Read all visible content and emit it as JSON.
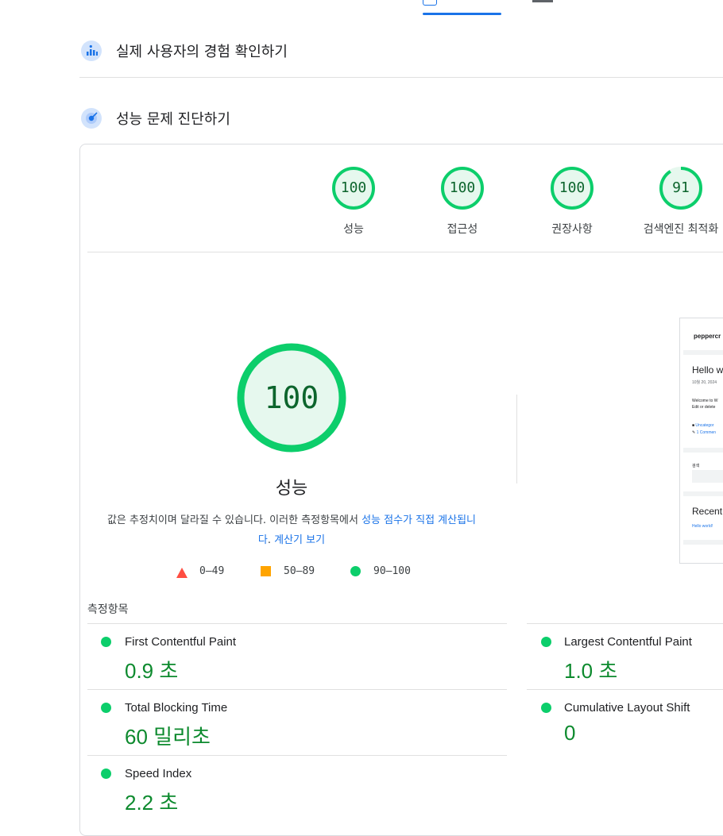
{
  "sections": {
    "field_data": {
      "title": "실제 사용자의 경험 확인하기"
    },
    "diagnose": {
      "title": "성능 문제 진단하기"
    }
  },
  "categories": [
    {
      "score": "100",
      "label": "성능",
      "fraction": 1.0
    },
    {
      "score": "100",
      "label": "접근성",
      "fraction": 1.0
    },
    {
      "score": "100",
      "label": "권장사항",
      "fraction": 1.0
    },
    {
      "score": "91",
      "label": "검색엔진 최적화",
      "fraction": 0.91
    }
  ],
  "performance": {
    "score": "100",
    "title": "성능",
    "desc_prefix": "값은 추정치이며 달라질 수 있습니다. 이러한 측정항목에서 ",
    "desc_link": "성능 점수가 직접 계산됩니다",
    "desc_suffix": ". ",
    "calc_link": "계산기 보기"
  },
  "legend": {
    "fail": "0–49",
    "average": "50–89",
    "pass": "90–100"
  },
  "metrics": {
    "header": "측정항목",
    "items": [
      {
        "name": "First Contentful Paint",
        "value": "0.9 초"
      },
      {
        "name": "Largest Contentful Paint",
        "value": "1.0 초"
      },
      {
        "name": "Total Blocking Time",
        "value": "60 밀리초"
      },
      {
        "name": "Cumulative Layout Shift",
        "value": "0"
      },
      {
        "name": "Speed Index",
        "value": "2.2 초"
      }
    ]
  },
  "thumbnail": {
    "site": "peppercr",
    "post_title": "Hello w",
    "date": "10월 20, 2024",
    "body1": "Welcome to W",
    "body2": "Edit or delete",
    "category": "Uncategor",
    "comments": "1 Commen",
    "search": "검색",
    "recent": "Recent",
    "recent_link": "Hello world!"
  },
  "colors": {
    "pass": "#0cce6b",
    "average": "#ffa400",
    "fail": "#ff4e42",
    "link": "#1a73e8"
  }
}
